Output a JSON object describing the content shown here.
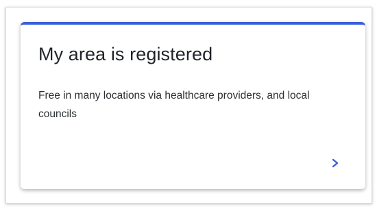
{
  "card": {
    "title": "My area is registered",
    "description": "Free in many locations via healthcare providers, and local councils",
    "accent_color": "#3a5fd8"
  },
  "icons": {
    "chevron": "chevron-right-icon"
  }
}
